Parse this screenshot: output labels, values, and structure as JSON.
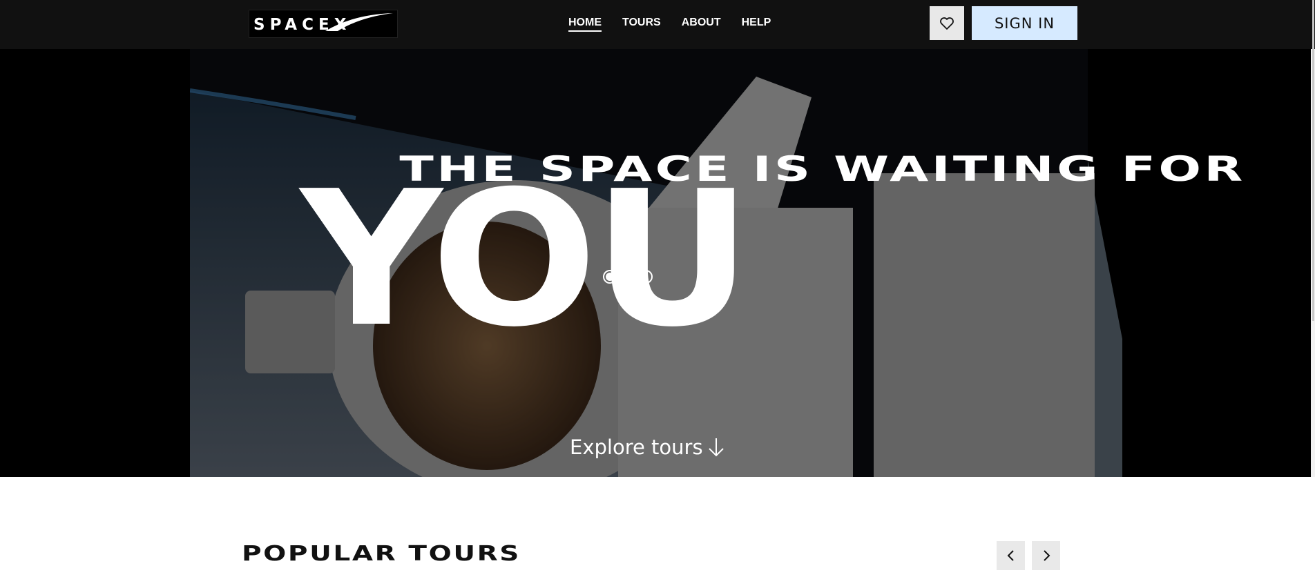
{
  "header": {
    "logo_text": "SPACEX",
    "nav": [
      {
        "label": "HOME",
        "active": true
      },
      {
        "label": "TOURS",
        "active": false
      },
      {
        "label": "ABOUT",
        "active": false
      },
      {
        "label": "HELP",
        "active": false
      }
    ],
    "favorites_icon": "heart-icon",
    "sign_in_label": "SIGN IN"
  },
  "hero": {
    "subtitle": "THE SPACE IS WAITING FOR",
    "title": "YOU",
    "slides": {
      "count": 3,
      "active_index": 0
    },
    "explore_label": "Explore tours",
    "explore_icon": "arrow-down-icon"
  },
  "popular": {
    "title": "POPULAR TOURS",
    "prev_icon": "chevron-left-icon",
    "next_icon": "chevron-right-icon"
  },
  "colors": {
    "header_bg": "#111111",
    "sign_in_bg": "#d6eaff",
    "favorites_bg": "#e8e8e8",
    "hero_bg": "#000000",
    "arrow_bg": "#e9e9e9"
  }
}
